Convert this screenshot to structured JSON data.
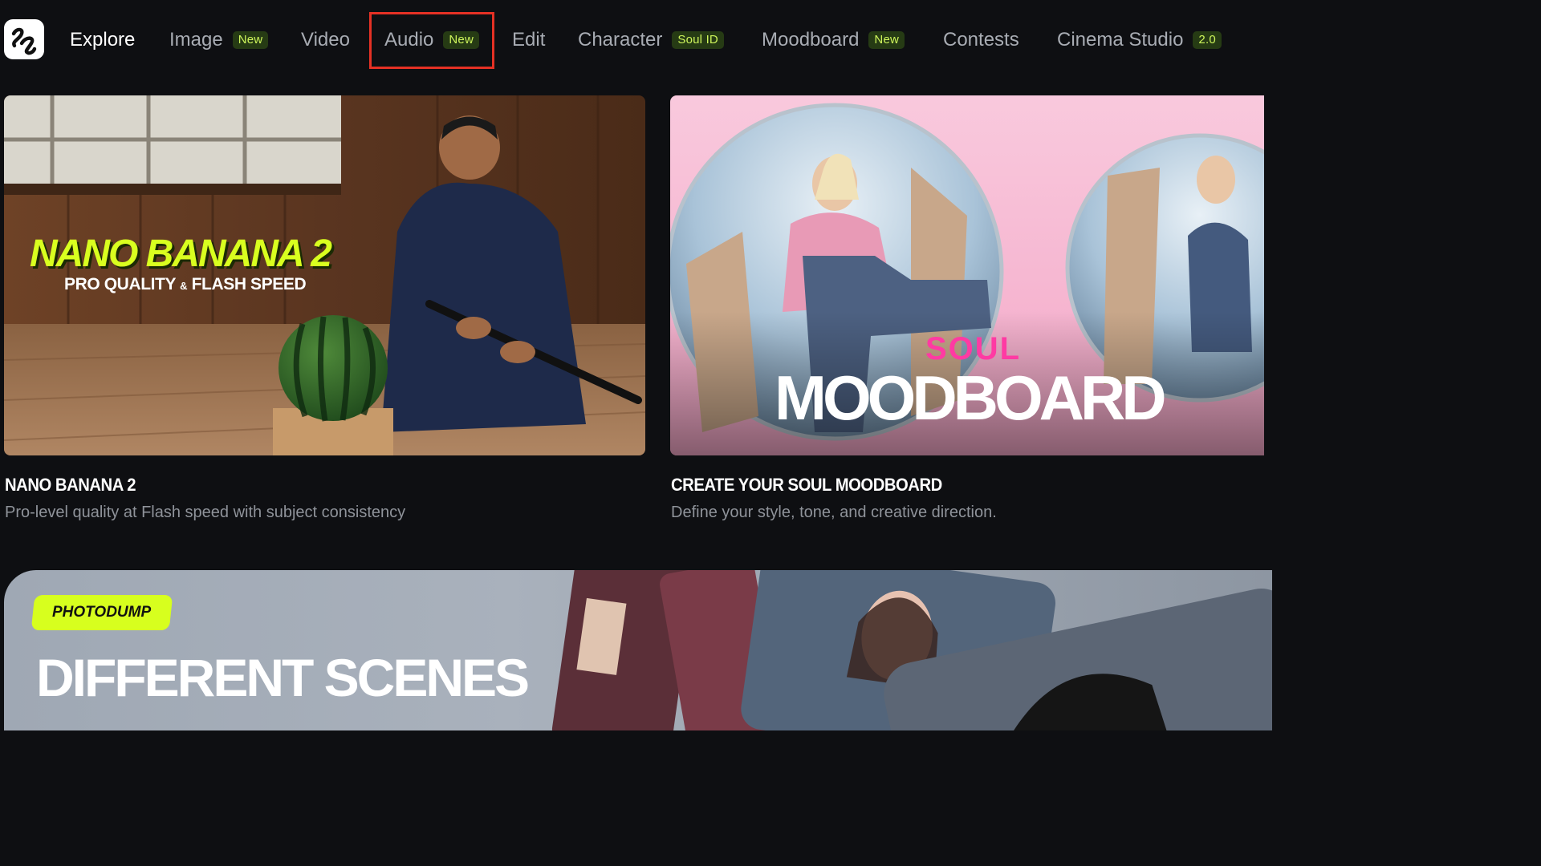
{
  "nav": {
    "logo_icon": "app-logo-icon",
    "items": [
      {
        "label": "Explore",
        "badge": ""
      },
      {
        "label": "Image",
        "badge": "New"
      },
      {
        "label": "Video",
        "badge": ""
      },
      {
        "label": "Audio",
        "badge": "New"
      },
      {
        "label": "Edit",
        "badge": ""
      },
      {
        "label": "Character",
        "badge": "Soul ID"
      },
      {
        "label": "Moodboard",
        "badge": "New"
      },
      {
        "label": "Contests",
        "badge": ""
      },
      {
        "label": "Cinema Studio",
        "badge": "2.0"
      }
    ],
    "highlighted_item": "Audio"
  },
  "cards": [
    {
      "image_title": "NANO BANANA 2",
      "image_subtitle_left": "PRO QUALITY",
      "image_subtitle_amp": "&",
      "image_subtitle_right": "FLASH SPEED",
      "title": "NANO BANANA 2",
      "description": "Pro-level quality at Flash speed with subject consistency"
    },
    {
      "image_word_top": "SOUL",
      "image_word_main": "MOODBOARD",
      "title": "CREATE YOUR SOUL MOODBOARD",
      "description": "Define your style, tone, and creative direction."
    }
  ],
  "banner": {
    "tag": "PHOTODUMP",
    "title": "DIFFERENT SCENES"
  },
  "colors": {
    "background": "#0e0f12",
    "accent_lime": "#d7ff1e",
    "badge_bg": "#263b14",
    "badge_text": "#cdf45b",
    "highlight_box": "#e53124",
    "soul_pink": "#ff3aa3"
  }
}
